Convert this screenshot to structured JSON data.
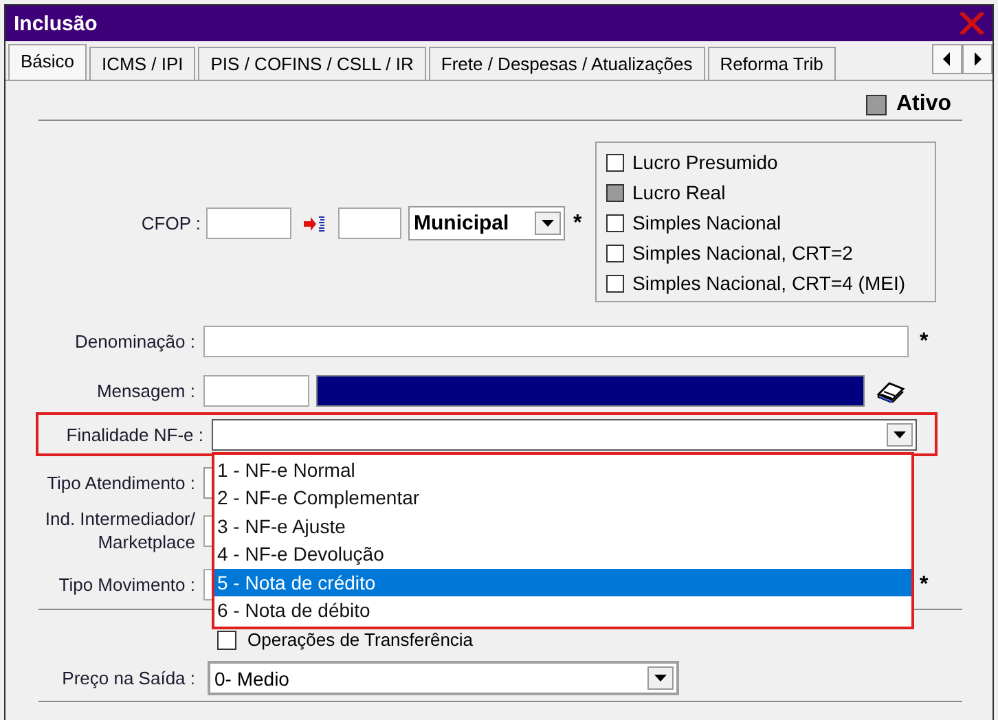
{
  "window": {
    "title": "Inclusão"
  },
  "tabs": [
    {
      "label": "Básico",
      "selected": true
    },
    {
      "label": "ICMS / IPI",
      "selected": false
    },
    {
      "label": "PIS / COFINS / CSLL / IR",
      "selected": false
    },
    {
      "label": "Frete / Despesas / Atualizações",
      "selected": false
    },
    {
      "label": "Reforma Trib",
      "selected": false
    }
  ],
  "ativo": {
    "label": "Ativo",
    "checked": true
  },
  "cfop": {
    "label": "CFOP :",
    "scope": "Municipal",
    "required_mark": "*"
  },
  "regimes": [
    {
      "label": "Lucro Presumido",
      "checked": false
    },
    {
      "label": "Lucro Real",
      "checked": true
    },
    {
      "label": "Simples Nacional",
      "checked": false
    },
    {
      "label": "Simples Nacional, CRT=2",
      "checked": false
    },
    {
      "label": "Simples Nacional, CRT=4 (MEI)",
      "checked": false
    }
  ],
  "denominacao": {
    "label": "Denominação :",
    "required_mark": "*"
  },
  "mensagem": {
    "label": "Mensagem :"
  },
  "finalidade": {
    "label": "Finalidade NF-e :",
    "expanded": true,
    "options": [
      {
        "label": "1 - NF-e Normal",
        "selected": false
      },
      {
        "label": "2 - NF-e Complementar",
        "selected": false
      },
      {
        "label": "3 - NF-e Ajuste",
        "selected": false
      },
      {
        "label": "4 - NF-e Devolução",
        "selected": false
      },
      {
        "label": "5 - Nota de crédito",
        "selected": true
      },
      {
        "label": "6 - Nota de débito",
        "selected": false
      }
    ]
  },
  "tipo_atendimento": {
    "label": "Tipo Atendimento :"
  },
  "ind_intermediador": {
    "label": "Ind. Intermediador/ Marketplace"
  },
  "tipo_movimento": {
    "label": "Tipo Movimento :",
    "required_mark": "*"
  },
  "operacoes_transferencia": {
    "label": "Operações de Transferência",
    "checked": false
  },
  "preco_saida": {
    "label": "Preço na Saída :",
    "value": "0- Medio"
  }
}
